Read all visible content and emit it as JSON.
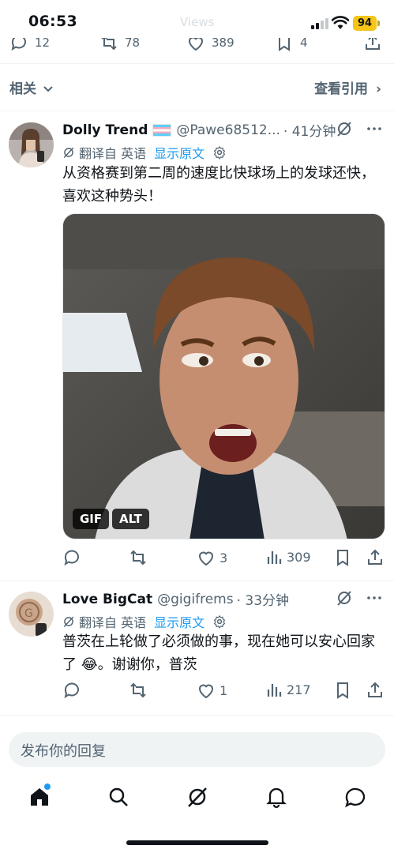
{
  "status_bar": {
    "time": "06:53",
    "faded_header": "Views",
    "battery": "94",
    "battery_color": "#f5c518"
  },
  "prev_actions": {
    "replies": "12",
    "reposts": "78",
    "likes": "389",
    "bookmarks": "4"
  },
  "related": {
    "label": "相关",
    "chevron_icon": "chevron-down-icon",
    "quotes_link": "查看引用",
    "quotes_chevron": "›"
  },
  "posts": [
    {
      "name": "Dolly Trend",
      "handle": "@Pawe68512...",
      "time": "· 41分钟",
      "translated_label": "翻译自 英语",
      "show_original": "显示原文",
      "text": "从资格赛到第二周的速度比快球场上的发球还快，喜欢这种势头！",
      "media_badges": [
        "GIF",
        "ALT"
      ],
      "stats": {
        "replies": "",
        "reposts": "",
        "likes": "3",
        "views": "309"
      }
    },
    {
      "name": "Love BigCat",
      "handle": "@gigifrems",
      "time": "· 33分钟",
      "translated_label": "翻译自 英语",
      "show_original": "显示原文",
      "text": "普茨在上轮做了必须做的事，现在她可以安心回家了 😂。谢谢你，普茨",
      "stats": {
        "replies": "",
        "reposts": "",
        "likes": "1",
        "views": "217"
      }
    }
  ],
  "reply": {
    "placeholder": "发布你的回复"
  },
  "tab_bar": {
    "icons": [
      "home-icon",
      "search-icon",
      "grok-icon",
      "notifications-icon",
      "messages-icon"
    ],
    "accent": "#1d9bf0"
  }
}
